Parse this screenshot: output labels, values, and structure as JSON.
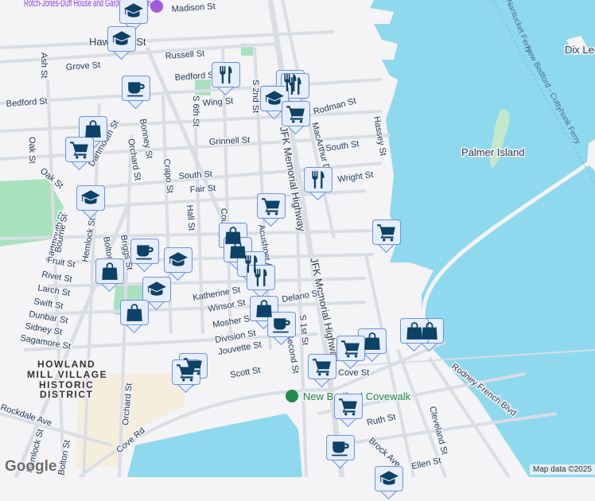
{
  "map": {
    "streets": [
      "Madison St",
      "Hawthorn St",
      "Russell St",
      "Grove St",
      "Ash St",
      "Bedford St",
      "Bedford St",
      "Wing St",
      "S 6th St",
      "S 2nd St",
      "Grinnell St",
      "Oak St",
      "Oak St",
      "Dartmouth St",
      "Orchard St",
      "Bonney St",
      "Crapo St",
      "South St",
      "Fair St",
      "Hall St",
      "County St",
      "Acushnet Ave",
      "JFK Memorial Highway",
      "JFK Memorial Highway",
      "MacArthur Dr",
      "Rodman St",
      "South St",
      "Wright St",
      "Hassey St",
      "Dartmouth St",
      "Bourne St",
      "Hemlock St",
      "Bolton St",
      "Briggs St",
      "Fruit St",
      "Rivet St",
      "Larch St",
      "Swift St",
      "Dunbar St",
      "Sidney St",
      "Sagamore St",
      "Katherine St",
      "Winsor St",
      "Mosher St",
      "Division St",
      "Jouvette St",
      "Scott St",
      "Rockdale Ave",
      "Cove Rd",
      "Orchard St",
      "Hemlock St",
      "Bolton St",
      "S 1st St",
      "Cove St",
      "Rodney French Blvd",
      "Ruth St",
      "Cleveland St",
      "Brock Ave",
      "Ellen St",
      "Delano St",
      "Second St"
    ],
    "places": {
      "museum": "Rotch-Jones-Duff House and Garden Museum",
      "island": "Palmer Island",
      "island2": "Dix Ledge",
      "district": [
        "HOWLAND",
        "MILL VILLAGE",
        "HISTORIC",
        "DISTRICT"
      ],
      "park": "New Bedford Covewalk",
      "ferry1": "New Bedford - Cuttyhunk Ferry",
      "ferry2": "Bedford - Nantucket Ferry"
    },
    "colors": {
      "water": "#8fd9ee",
      "land": "#f4f3f5",
      "park": "#a8e2bd",
      "marker_bg": "#e6edfc",
      "icon": "#0c4266"
    }
  },
  "footer": {
    "logo": "Google",
    "attribution": "Map data ©2025"
  }
}
